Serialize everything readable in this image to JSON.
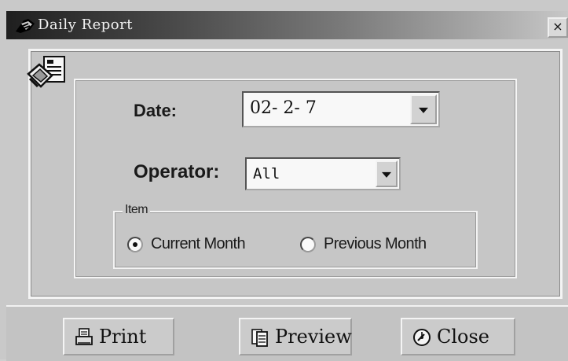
{
  "window": {
    "title": "Daily Report"
  },
  "form": {
    "date_label": "Date:",
    "date_value": "02- 2- 7",
    "operator_label": "Operator:",
    "operator_value": "All",
    "group_label": "Item",
    "options": [
      {
        "label": "Current Month",
        "selected": true
      },
      {
        "label": "Previous Month",
        "selected": false
      }
    ]
  },
  "buttons": {
    "print": "Print",
    "preview": "Preview",
    "close": "Close"
  },
  "icons": {
    "app": "report-app-icon",
    "title": "title-logo-icon",
    "print": "printer-icon",
    "preview": "preview-pages-icon",
    "close": "close-clock-icon"
  }
}
